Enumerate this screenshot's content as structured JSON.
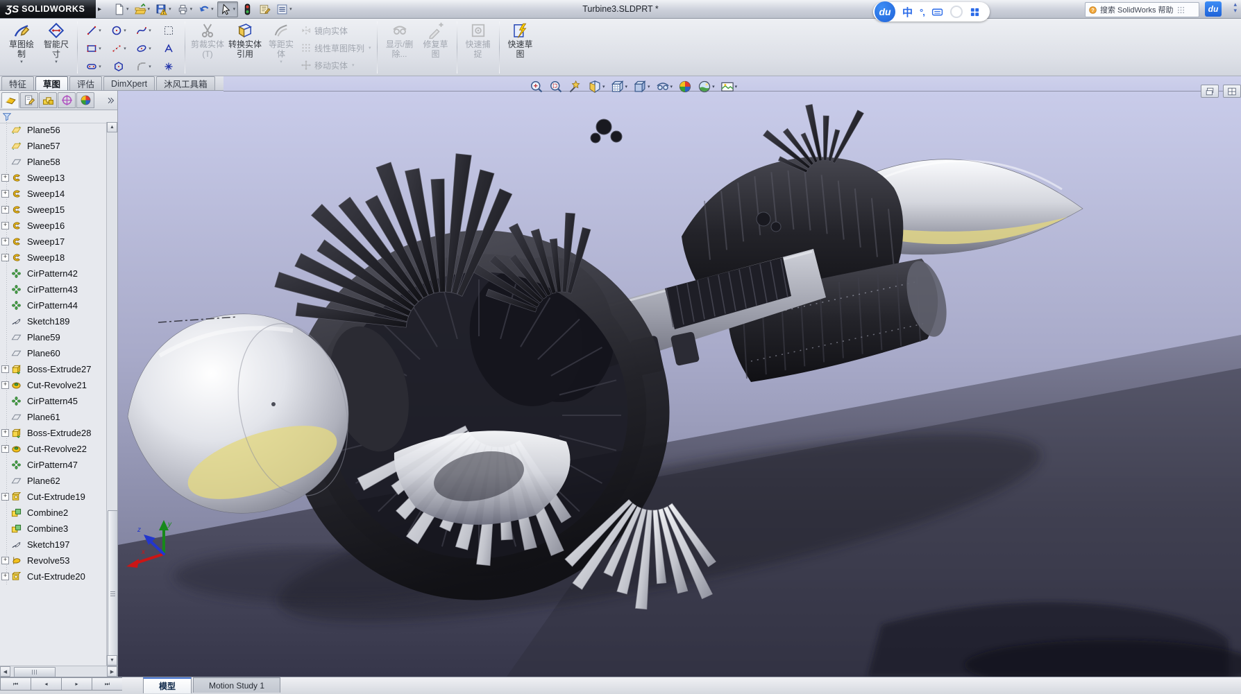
{
  "window": {
    "brand_prefix": "ƷS",
    "brand": "SOLIDWORKS",
    "title": "Turbine3.SLDPRT *",
    "menu_arrow": "▸"
  },
  "colors": {
    "accent_blue": "#2a6ae8",
    "viewport_top": "#c9ccea",
    "viewport_floor": "#36364a",
    "ribbon_bg": "#dde0e7"
  },
  "quick_toolbar": {
    "items": [
      {
        "name": "new-document",
        "caret": true
      },
      {
        "name": "open",
        "caret": true
      },
      {
        "name": "save",
        "caret": true
      },
      {
        "name": "print",
        "caret": true
      },
      {
        "name": "undo",
        "caret": true
      },
      {
        "name": "select",
        "caret": true,
        "active": true
      },
      {
        "name": "rebuild",
        "caret": false
      },
      {
        "name": "file-properties",
        "caret": false
      },
      {
        "name": "options",
        "caret": true
      }
    ]
  },
  "ime_bar": {
    "logo": "du",
    "mode_label": "中",
    "punct_label": "°,"
  },
  "help_search": {
    "text": "搜索 SolidWorks 帮助",
    "du_badge": "du"
  },
  "ribbon": {
    "groups": [
      {
        "type": "big",
        "items": [
          {
            "label": "草图绘制",
            "icon": "sketch-draw",
            "enabled": true,
            "caret": true
          },
          {
            "label": "智能尺寸",
            "icon": "smart-dimension",
            "enabled": true,
            "caret": true
          }
        ]
      },
      {
        "type": "sep"
      },
      {
        "type": "grid",
        "rows": [
          [
            {
              "icon": "line",
              "caret": true,
              "enabled": true
            },
            {
              "icon": "circle",
              "caret": true,
              "enabled": true
            },
            {
              "icon": "spline",
              "caret": true,
              "enabled": true
            },
            {
              "icon": "selection-box",
              "caret": false,
              "enabled": true
            }
          ],
          [
            {
              "icon": "rectangle",
              "caret": true,
              "enabled": true
            },
            {
              "icon": "points",
              "caret": true,
              "enabled": true
            },
            {
              "icon": "ellipse",
              "caret": true,
              "enabled": true
            },
            {
              "icon": "text",
              "caret": false,
              "enabled": true
            }
          ],
          [
            {
              "icon": "slot",
              "caret": true,
              "enabled": true
            },
            {
              "icon": "polygon",
              "caret": false,
              "enabled": true
            },
            {
              "icon": "fillet",
              "caret": true,
              "enabled": false
            },
            {
              "icon": "point",
              "caret": false,
              "enabled": true
            }
          ]
        ]
      },
      {
        "type": "sep"
      },
      {
        "type": "big",
        "items": [
          {
            "label": "剪裁实体(T)",
            "icon": "trim-entities",
            "enabled": false,
            "caret": false
          },
          {
            "label": "转换实体引用",
            "icon": "convert-entities",
            "enabled": true,
            "caret": false
          },
          {
            "label": "等距实体",
            "icon": "offset-entities",
            "enabled": false,
            "caret": true
          }
        ]
      },
      {
        "type": "stack",
        "items": [
          {
            "label": "镜向实体",
            "icon": "mirror-entities",
            "enabled": false,
            "caret": false
          },
          {
            "label": "线性草图阵列",
            "icon": "linear-pattern",
            "enabled": false,
            "caret": true
          },
          {
            "label": "移动实体",
            "icon": "move-entities",
            "enabled": false,
            "caret": true
          }
        ]
      },
      {
        "type": "sep"
      },
      {
        "type": "big",
        "items": [
          {
            "label": "显示/删除...",
            "icon": "display-delete",
            "enabled": false,
            "caret": false
          },
          {
            "label": "修复草图",
            "icon": "repair-sketch",
            "enabled": false,
            "caret": false
          }
        ]
      },
      {
        "type": "sep"
      },
      {
        "type": "big",
        "items": [
          {
            "label": "快速捕捉",
            "icon": "quick-snaps",
            "enabled": false,
            "caret": false
          }
        ]
      },
      {
        "type": "sep"
      },
      {
        "type": "big",
        "items": [
          {
            "label": "快速草图",
            "icon": "rapid-sketch",
            "enabled": true,
            "caret": false
          }
        ]
      }
    ]
  },
  "command_tabs": {
    "items": [
      "特征",
      "草图",
      "评估",
      "DimXpert",
      "沐风工具箱"
    ],
    "active_index": 1
  },
  "heads_up": {
    "items": [
      {
        "name": "zoom-fit",
        "caret": false
      },
      {
        "name": "zoom-area",
        "caret": false
      },
      {
        "name": "view-selector",
        "caret": false
      },
      {
        "name": "section-view",
        "caret": true
      },
      {
        "name": "view-orientation",
        "caret": true
      },
      {
        "name": "display-style",
        "caret": true
      },
      {
        "name": "hide-show-items",
        "caret": true
      },
      {
        "name": "edit-appearance",
        "caret": false
      },
      {
        "name": "apply-scene",
        "caret": true
      },
      {
        "name": "view-settings",
        "caret": true
      }
    ]
  },
  "feature_panel": {
    "tabs": [
      "feature-manager",
      "property-manager",
      "configuration-manager",
      "dimxpert-manager",
      "display-manager"
    ],
    "chevron": "»",
    "tree": [
      {
        "label": "Plane56",
        "icon": "plane-gold",
        "exp": false
      },
      {
        "label": "Plane57",
        "icon": "plane-gold",
        "exp": false
      },
      {
        "label": "Plane58",
        "icon": "plane",
        "exp": false
      },
      {
        "label": "Sweep13",
        "icon": "sweep",
        "exp": true
      },
      {
        "label": "Sweep14",
        "icon": "sweep",
        "exp": true
      },
      {
        "label": "Sweep15",
        "icon": "sweep",
        "exp": true
      },
      {
        "label": "Sweep16",
        "icon": "sweep",
        "exp": true
      },
      {
        "label": "Sweep17",
        "icon": "sweep",
        "exp": true
      },
      {
        "label": "Sweep18",
        "icon": "sweep",
        "exp": true
      },
      {
        "label": "CirPattern42",
        "icon": "cirpattern",
        "exp": false
      },
      {
        "label": "CirPattern43",
        "icon": "cirpattern",
        "exp": false
      },
      {
        "label": "CirPattern44",
        "icon": "cirpattern",
        "exp": false
      },
      {
        "label": "Sketch189",
        "icon": "sketch",
        "exp": false
      },
      {
        "label": "Plane59",
        "icon": "plane",
        "exp": false
      },
      {
        "label": "Plane60",
        "icon": "plane",
        "exp": false
      },
      {
        "label": "Boss-Extrude27",
        "icon": "boss-extrude",
        "exp": true
      },
      {
        "label": "Cut-Revolve21",
        "icon": "cut-revolve",
        "exp": true
      },
      {
        "label": "CirPattern45",
        "icon": "cirpattern",
        "exp": false
      },
      {
        "label": "Plane61",
        "icon": "plane",
        "exp": false
      },
      {
        "label": "Boss-Extrude28",
        "icon": "boss-extrude",
        "exp": true
      },
      {
        "label": "Cut-Revolve22",
        "icon": "cut-revolve",
        "exp": true
      },
      {
        "label": "CirPattern47",
        "icon": "cirpattern",
        "exp": false
      },
      {
        "label": "Plane62",
        "icon": "plane",
        "exp": false
      },
      {
        "label": "Cut-Extrude19",
        "icon": "cut-extrude",
        "exp": true
      },
      {
        "label": "Combine2",
        "icon": "combine",
        "exp": false
      },
      {
        "label": "Combine3",
        "icon": "combine",
        "exp": false
      },
      {
        "label": "Sketch197",
        "icon": "sketch",
        "exp": false
      },
      {
        "label": "Revolve53",
        "icon": "revolve",
        "exp": true
      },
      {
        "label": "Cut-Extrude20",
        "icon": "cut-extrude",
        "exp": true
      }
    ]
  },
  "viewport": {
    "triad": {
      "x": "x",
      "y": "y",
      "z": "z"
    }
  },
  "status_bar": {
    "nav": [
      "⏮",
      "◂",
      "▸",
      "⏭"
    ],
    "tabs": [
      {
        "label": "模型",
        "active": true
      },
      {
        "label": "Motion Study 1",
        "active": false
      }
    ]
  }
}
